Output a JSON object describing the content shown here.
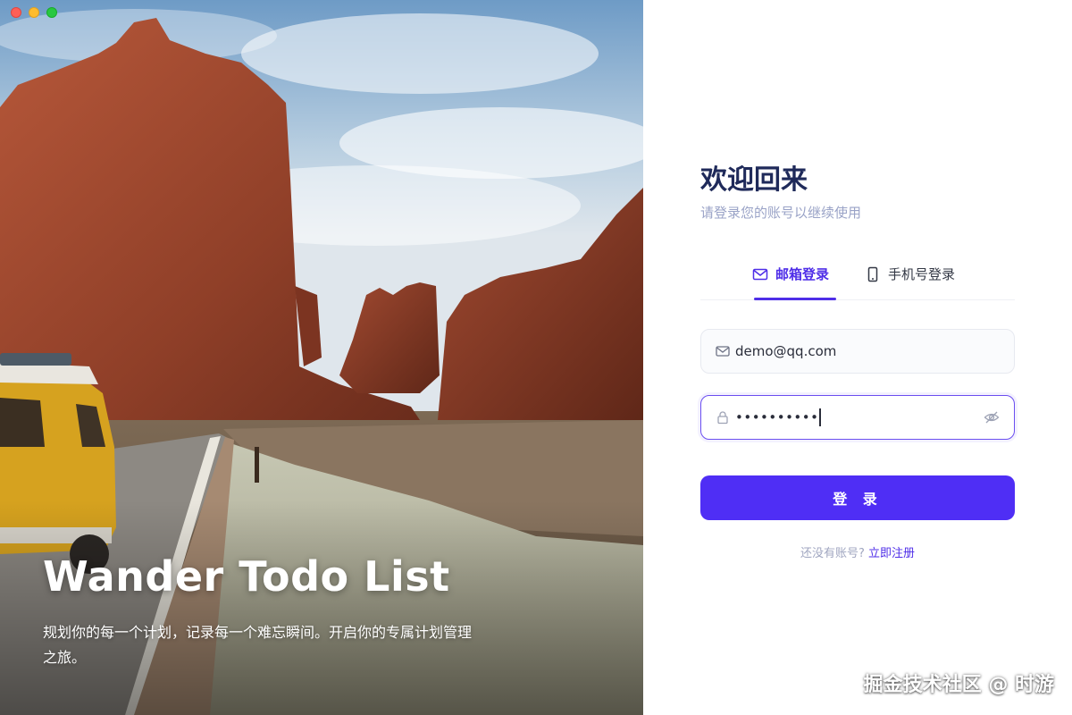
{
  "window": {
    "controls": [
      "close",
      "minimize",
      "maximize"
    ]
  },
  "hero": {
    "title": "Wander Todo List",
    "description": "规划你的每一个计划，记录每一个难忘瞬间。开启你的专属计划管理之旅。"
  },
  "login": {
    "welcome": "欢迎回来",
    "subtitle": "请登录您的账号以继续使用",
    "tabs": [
      {
        "label": "邮箱登录",
        "icon": "mail-icon",
        "active": true
      },
      {
        "label": "手机号登录",
        "icon": "phone-icon",
        "active": false
      }
    ],
    "email_value": "demo@qq.com",
    "password_value": "••••••••••",
    "submit_label": "登 录",
    "signup_hint": "还没有账号? ",
    "signup_link": "立即注册"
  },
  "watermark": "掘金技术社区 @ 时游",
  "colors": {
    "accent": "#4f2ef5",
    "title": "#1f2a5a",
    "muted": "#9aa3c7"
  }
}
